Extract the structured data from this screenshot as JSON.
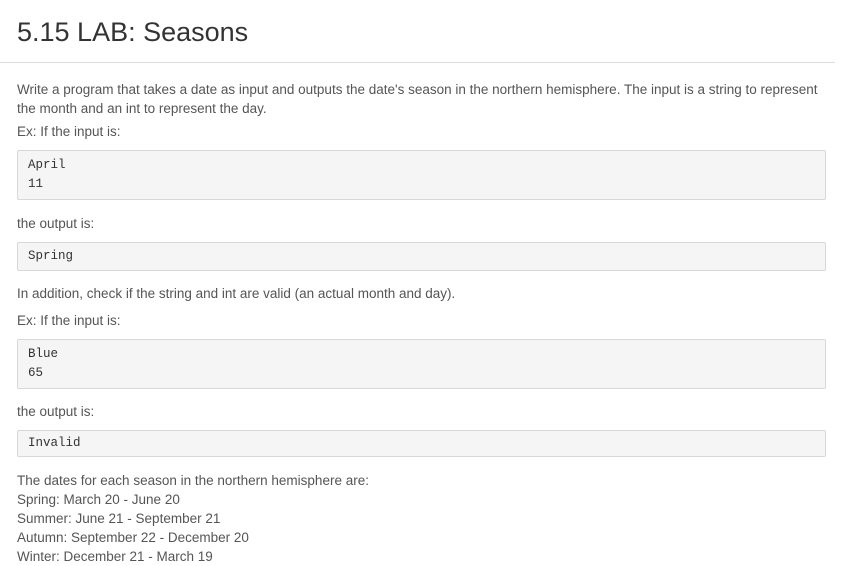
{
  "title": "5.15 LAB: Seasons",
  "intro": "Write a program that takes a date as input and outputs the date's season in the northern hemisphere. The input is a string to represent the month and an int to represent the day.",
  "example1_label": "Ex: If the input is:",
  "example1_input": [
    "April",
    "11"
  ],
  "output1_label": "the output is:",
  "example1_output": [
    "Spring"
  ],
  "additional": "In addition, check if the string and int are valid (an actual month and day).",
  "example2_label": "Ex: If the input is:",
  "example2_input": [
    "Blue",
    "65"
  ],
  "output2_label": "the output is:",
  "example2_output": [
    "Invalid"
  ],
  "dates_intro": "The dates for each season in the northern hemisphere are:",
  "seasons": [
    "Spring: March 20 - June 20",
    "Summer: June 21 - September 21",
    "Autumn: September 22 - December 20",
    "Winter: December 21 - March 19"
  ]
}
